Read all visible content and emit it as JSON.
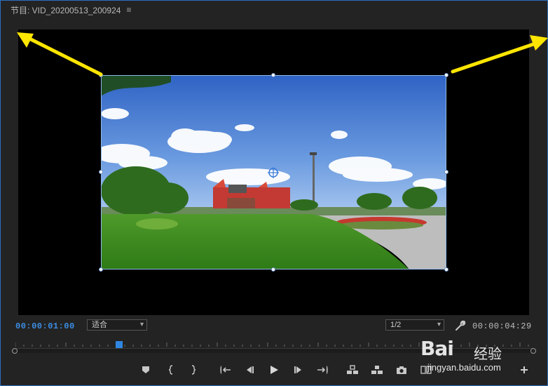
{
  "panel": {
    "title": "节目: VID_20200513_200924",
    "menu_icon": "≡"
  },
  "timebar": {
    "current_time": "00:00:01:00",
    "zoom_select": "适合",
    "resolution_select": "1/2",
    "duration": "00:00:04:29"
  },
  "playback": {
    "position_fraction": 0.2
  },
  "controls": [
    {
      "name": "add-marker",
      "icon": "marker-icon"
    },
    {
      "name": "mark-in",
      "icon": "mark-in-icon"
    },
    {
      "name": "mark-out",
      "icon": "mark-out-icon"
    },
    {
      "name": "go-to-in",
      "icon": "go-to-in-icon"
    },
    {
      "name": "step-back",
      "icon": "step-back-icon"
    },
    {
      "name": "play",
      "icon": "play-icon"
    },
    {
      "name": "step-forward",
      "icon": "step-forward-icon"
    },
    {
      "name": "go-to-out",
      "icon": "go-to-out-icon"
    },
    {
      "name": "lift",
      "icon": "lift-icon"
    },
    {
      "name": "extract",
      "icon": "extract-icon"
    },
    {
      "name": "export-frame",
      "icon": "camera-icon"
    },
    {
      "name": "comparison-view",
      "icon": "compare-icon"
    },
    {
      "name": "button-editor",
      "icon": "plus-icon"
    }
  ],
  "watermark": {
    "logo": "Bai",
    "logo_suffix": "经验",
    "url": "jingyan.baidu.com"
  },
  "colors": {
    "accent": "#2f86e0",
    "annotation_arrow": "#ffe600",
    "background": "#232323"
  }
}
